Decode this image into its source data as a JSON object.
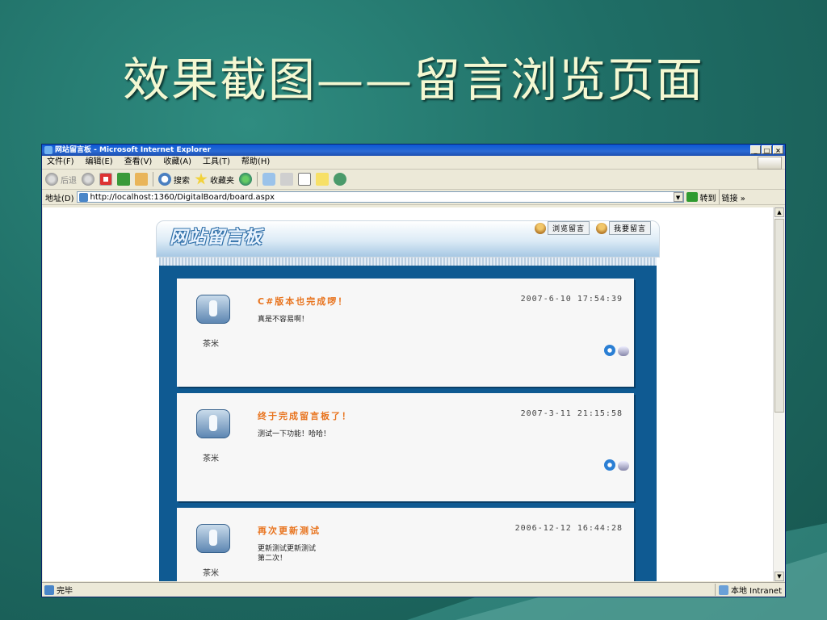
{
  "slide": {
    "title": "效果截图——留言浏览页面"
  },
  "window": {
    "title": "网站留言板 - Microsoft Internet Explorer",
    "buttons": [
      "_",
      "□",
      "×"
    ]
  },
  "menu": [
    "文件(F)",
    "编辑(E)",
    "查看(V)",
    "收藏(A)",
    "工具(T)",
    "帮助(H)"
  ],
  "toolbar": {
    "back": "后退",
    "search": "搜索",
    "favorites": "收藏夹"
  },
  "address": {
    "label": "地址(D)",
    "url": "http://localhost:1360/DigitalBoard/board.aspx",
    "go": "转到",
    "links": "链接 »"
  },
  "status": {
    "text": "完毕",
    "zone": "本地 Intranet"
  },
  "board": {
    "logo": "网站留言板",
    "browse_label": "浏览留言",
    "post_label": "我要留言",
    "messages": [
      {
        "title": "C#版本也完成啰！",
        "time": "2007-6-10 17:54:39",
        "body": "真是不容易啊！",
        "author": "茶米"
      },
      {
        "title": "终于完成留言板了！",
        "time": "2007-3-11 21:15:58",
        "body": "测试一下功能！哈哈！",
        "author": "茶米"
      },
      {
        "title": "再次更新测试",
        "time": "2006-12-12 16:44:28",
        "body": "更新测试更新测试\n第二次！",
        "author": "茶米"
      }
    ]
  },
  "colors": {
    "accent": "#e8731d",
    "board_blue": "#0f5a92",
    "slide_title": "#f4f8d2"
  }
}
